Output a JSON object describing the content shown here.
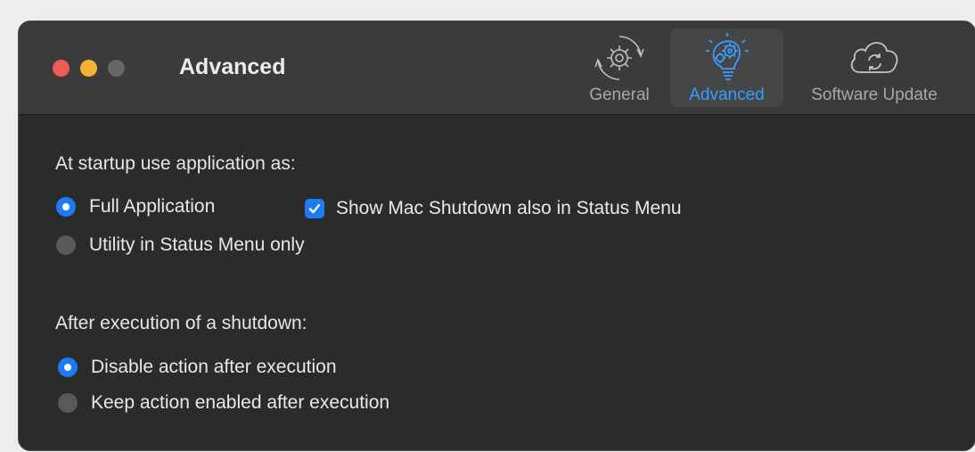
{
  "window": {
    "title": "Advanced"
  },
  "toolbar": {
    "tabs": [
      {
        "label": "General",
        "icon": "gear-icon",
        "selected": false
      },
      {
        "label": "Advanced",
        "icon": "lightbulb-gears-icon",
        "selected": true
      },
      {
        "label": "Software Update",
        "icon": "cloud-sync-icon",
        "selected": false
      }
    ]
  },
  "startup": {
    "heading": "At startup use application as:",
    "options": [
      {
        "label": "Full Application",
        "selected": true
      },
      {
        "label": "Utility in Status Menu only",
        "selected": false
      }
    ],
    "checkbox": {
      "label": "Show Mac Shutdown also in Status Menu",
      "checked": true
    }
  },
  "after_shutdown": {
    "heading": "After execution of a shutdown:",
    "options": [
      {
        "label": "Disable action after execution",
        "selected": true
      },
      {
        "label": "Keep action enabled after execution",
        "selected": false
      }
    ]
  },
  "colors": {
    "accent": "#1d7bf7",
    "window_bg": "#2a2b2b",
    "titlebar_bg": "#3b3b3b",
    "close": "#ee5b59",
    "minimize": "#f4b334",
    "zoom_disabled": "#666666"
  }
}
